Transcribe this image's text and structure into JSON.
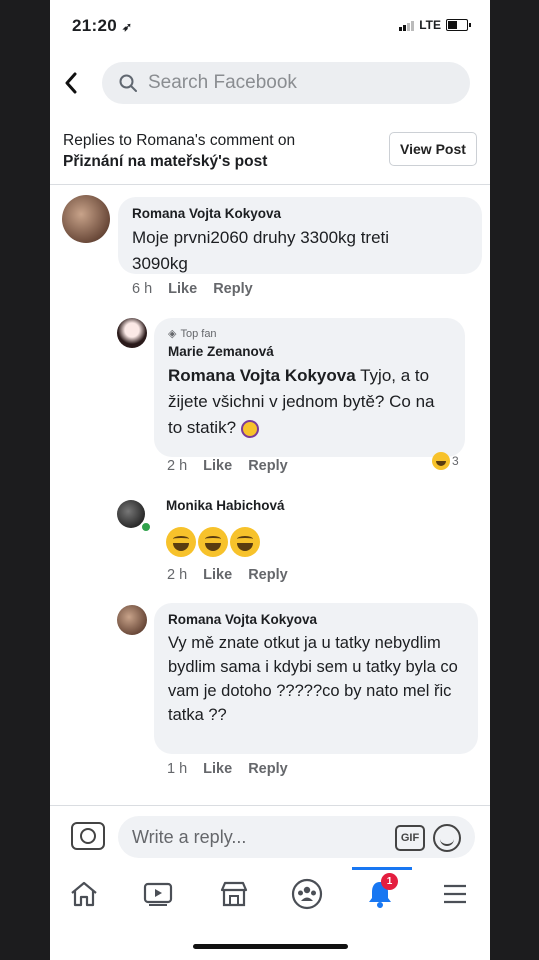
{
  "status": {
    "time": "21:20",
    "network": "LTE"
  },
  "search": {
    "placeholder": "Search Facebook"
  },
  "header": {
    "line1": "Replies to Romana's comment on",
    "line2": "Přiznání na mateřský's post",
    "view_post": "View Post"
  },
  "comments": [
    {
      "author": "Romana Vojta Kokyova",
      "text": "Moje prvni2060 druhy 3300kg treti 3090kg",
      "time": "6 h",
      "like": "Like",
      "reply": "Reply"
    },
    {
      "badge": "Top fan",
      "author": "Marie Zemanová",
      "mention": "Romana Vojta Kokyova",
      "text": " Tyjo, a to žijete všichni v jednom bytě? Co na to statik? ",
      "time": "2 h",
      "like": "Like",
      "reply": "Reply",
      "reaction_count": "3"
    },
    {
      "author": "Monika Habichová",
      "text_emoji": "😂😂😂",
      "time": "2 h",
      "like": "Like",
      "reply": "Reply"
    },
    {
      "author": "Romana Vojta Kokyova",
      "text": "Vy mě znate otkut  ja u tatky nebydlim bydlim sama  i kdybi sem u tatky byla co vam je dotoho ?????co by nato mel řic tatka ??",
      "time": "1 h",
      "like": "Like",
      "reply": "Reply"
    }
  ],
  "reply_box": {
    "placeholder": "Write a reply...",
    "gif_label": "GIF"
  },
  "tabbar": {
    "items": [
      "home-icon",
      "watch-icon",
      "marketplace-icon",
      "groups-icon",
      "notifications-icon",
      "menu-icon"
    ],
    "notification_badge": "1"
  },
  "colors": {
    "accent": "#1877f2",
    "bubble": "#f0f2f5",
    "badge": "#e41e3f"
  }
}
